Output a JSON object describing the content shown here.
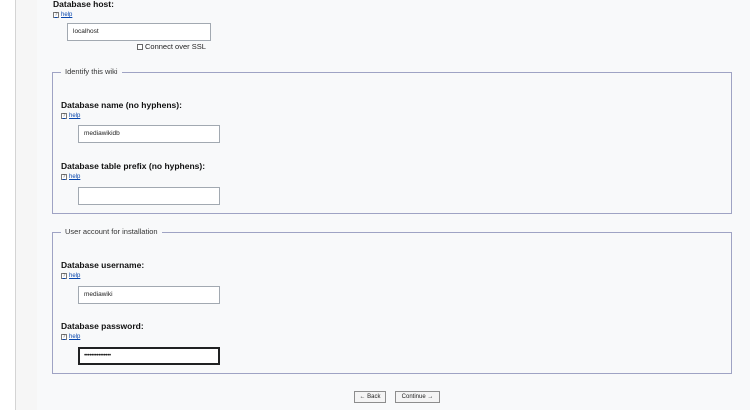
{
  "host": {
    "label": "Database host:",
    "help": "help",
    "value": "localhost",
    "ssl_label": "Connect over SSL"
  },
  "identify": {
    "legend": "Identify this wiki",
    "dbname_label": "Database name (no hyphens):",
    "dbname_help": "help",
    "dbname_value": "mediawikidb",
    "prefix_label": "Database table prefix (no hyphens):",
    "prefix_help": "help",
    "prefix_value": ""
  },
  "account": {
    "legend": "User account for installation",
    "user_label": "Database username:",
    "user_help": "help",
    "user_value": "mediawiki",
    "pass_label": "Database password:",
    "pass_help": "help",
    "pass_value": "•••••••••••••••"
  },
  "buttons": {
    "back": "← Back",
    "continue": "Continue →"
  }
}
